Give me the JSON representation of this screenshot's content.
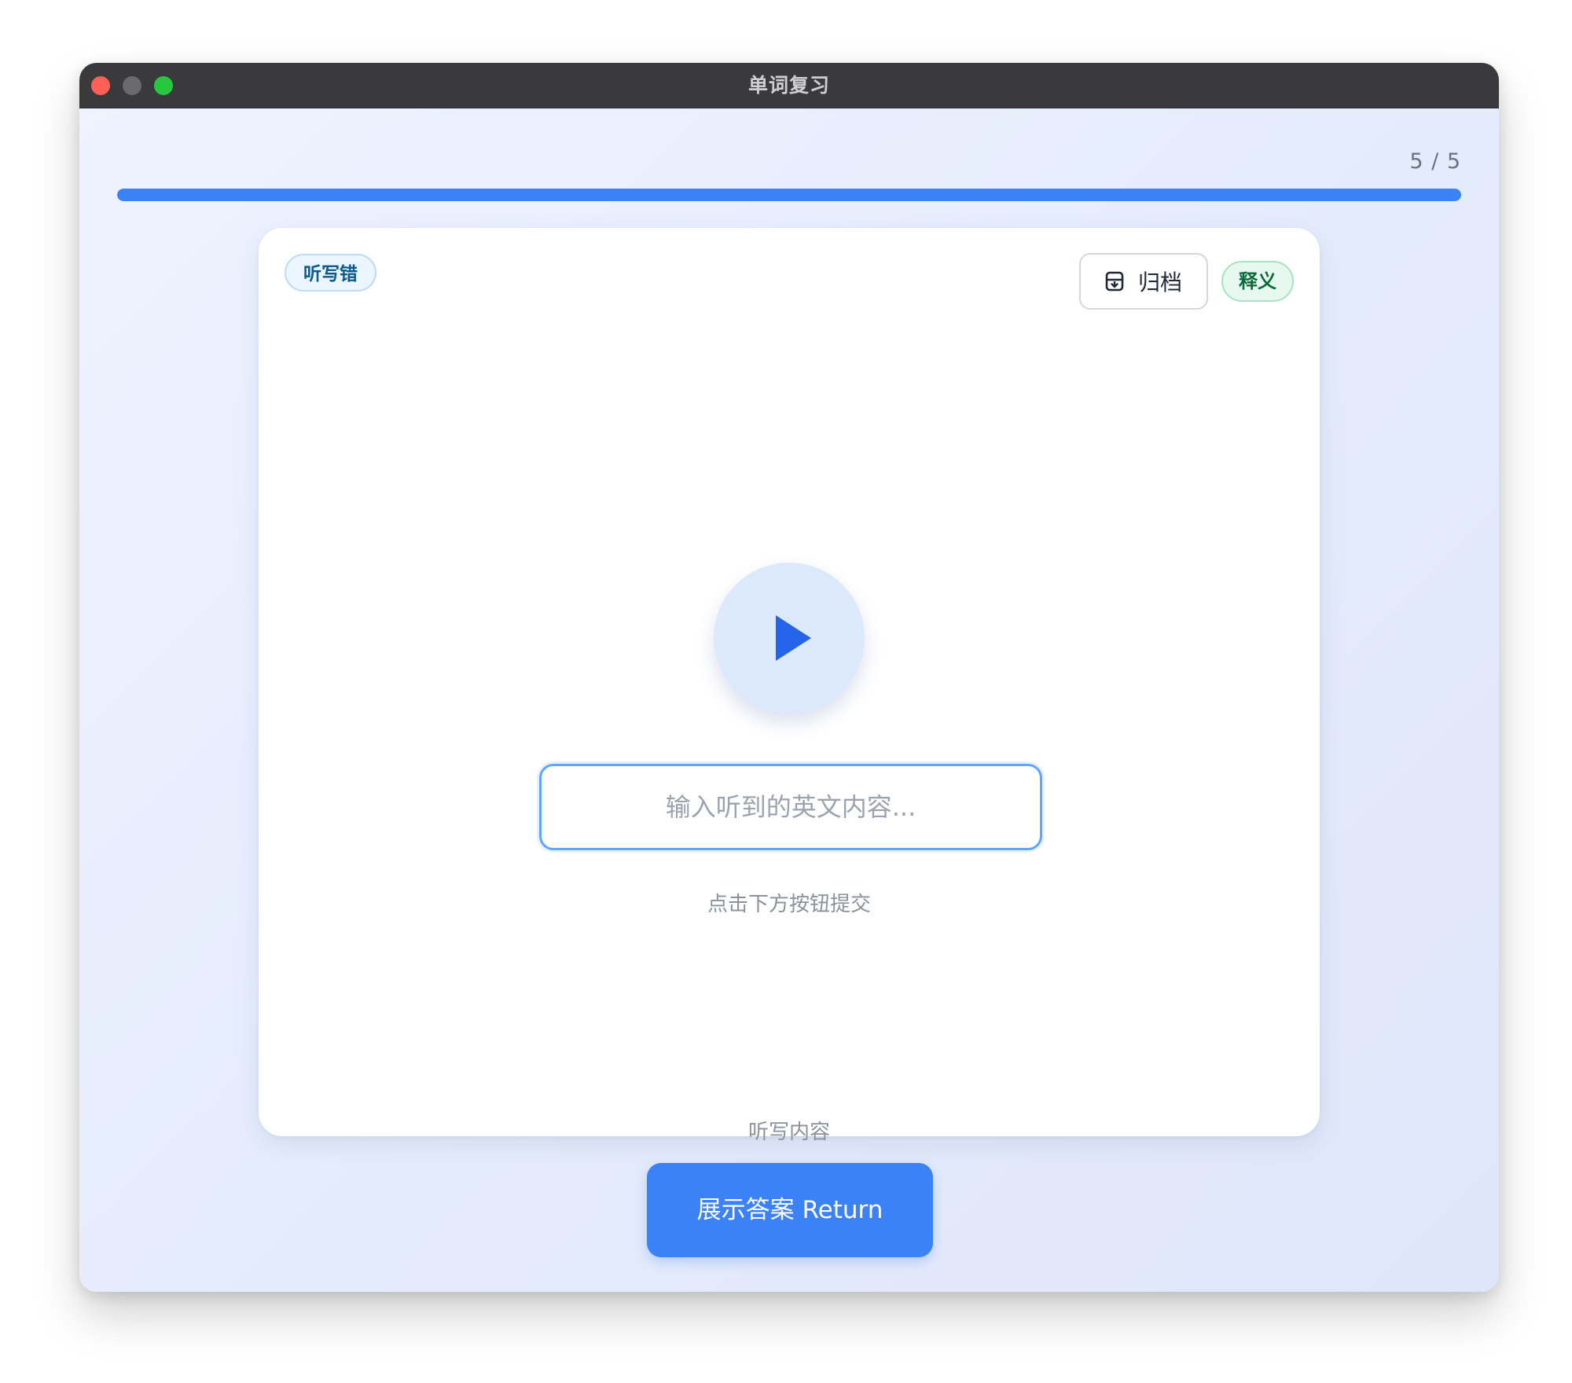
{
  "window": {
    "title": "单词复习"
  },
  "progress": {
    "count_text": "5 / 5",
    "current": 5,
    "total": 5,
    "fraction": 1.0,
    "color": "#3b82f6"
  },
  "card": {
    "status_badge": "听写错",
    "archive_label": "归档",
    "meaning_label": "释义",
    "input_placeholder": "输入听到的英文内容...",
    "input_value": "",
    "hint": "点击下方按钮提交",
    "footer_label": "听写内容"
  },
  "actions": {
    "reveal_label": "展示答案 Return"
  },
  "icons": {
    "play": "play-icon",
    "archive": "archive-icon"
  },
  "colors": {
    "accent": "#3b82f6",
    "play_bg": "#dce9fc",
    "play_icon": "#2563eb",
    "error_badge_text": "#0b5a8c",
    "meaning_badge_text": "#0a6b3a"
  }
}
